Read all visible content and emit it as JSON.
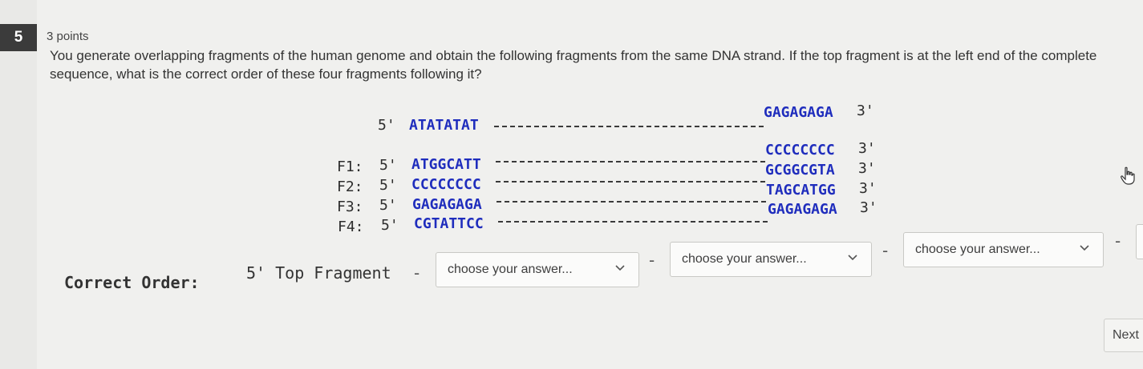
{
  "question": {
    "number": "5",
    "points": "3 points",
    "prompt": "You generate overlapping fragments of the human genome and obtain the following fragments from the same DNA strand. If the top fragment is at the left end of the complete sequence, what is the correct order of these four fragments following it?"
  },
  "top_fragment": {
    "prime5": "5'",
    "left": "ATATATAT",
    "right": "GAGAGAGA",
    "prime3": "3'"
  },
  "fragments": [
    {
      "name": "F1:",
      "prime5": "5'",
      "left": "ATGGCATT",
      "right": "CCCCCCCC",
      "prime3": "3'"
    },
    {
      "name": "F2:",
      "prime5": "5'",
      "left": "CCCCCCCC",
      "right": "GCGGCGTA",
      "prime3": "3'"
    },
    {
      "name": "F3:",
      "prime5": "5'",
      "left": "GAGAGAGA",
      "right": "TAGCATGG",
      "prime3": "3'"
    },
    {
      "name": "F4:",
      "prime5": "5'",
      "left": "CGTATTCC",
      "right": "GAGAGAGA",
      "prime3": "3'"
    }
  ],
  "order": {
    "label": "Correct Order:",
    "start": "5' Top Fragment",
    "separator": "-",
    "placeholder": "choose your answer..."
  },
  "nav": {
    "next": "Next"
  },
  "icons": {
    "chevron": "chevron-down-icon",
    "cursor": "hand-pointer-icon"
  }
}
